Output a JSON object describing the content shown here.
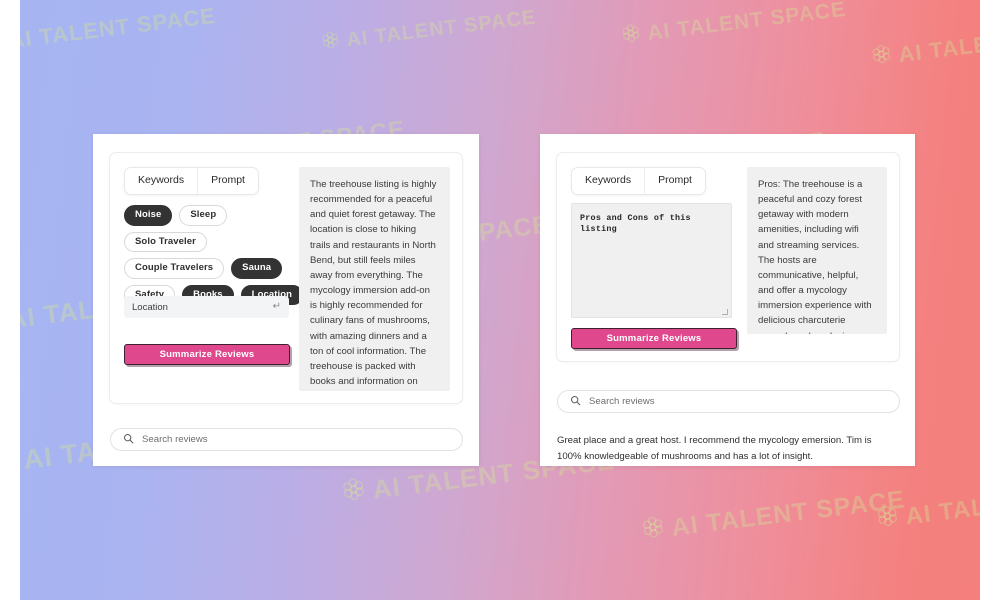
{
  "background": {
    "gradient_start": "#a6b5f2",
    "gradient_mid": "#d0a7cf",
    "gradient_end": "#f4817f",
    "watermark_text": "AI TALENT SPACE",
    "watermark_color": "#d6e296",
    "watermark_icon": "flower-cluster-icon"
  },
  "theme": {
    "chip_active_bg": "#333333",
    "chip_inactive_bg": "#ffffff",
    "button_bg": "#e0488e",
    "summary_bg": "#f0f0f0",
    "card_bg": "#ffffff"
  },
  "left_panel": {
    "tabs": [
      {
        "label": "Keywords",
        "selected": true
      },
      {
        "label": "Prompt",
        "selected": false
      }
    ],
    "chips": [
      {
        "label": "Noise",
        "selected": true
      },
      {
        "label": "Sleep",
        "selected": false
      },
      {
        "label": "Solo Traveler",
        "selected": false
      },
      {
        "label": "Couple Travelers",
        "selected": false
      },
      {
        "label": "Sauna",
        "selected": true
      },
      {
        "label": "Safety",
        "selected": false
      },
      {
        "label": "Books",
        "selected": true
      },
      {
        "label": "Location",
        "selected": true
      }
    ],
    "location_input": {
      "value": "Location",
      "placeholder": "Location",
      "enter_key_glyph": "↵"
    },
    "summarize_button": "Summarize Reviews",
    "summary_text": "The treehouse listing is highly recommended for a peaceful and quiet forest getaway. The location is close to hiking trails and restaurants in North Bend, but still feels miles away from everything. The mycology immersion add-on is highly recommended for culinary fans of mushrooms, with amazing dinners and a ton of cool information. The treehouse is packed with books and information on mycology, and the outdoor shower is a favorite among guests. The hosts are very nice, helpful, and communicative.",
    "search": {
      "placeholder": "Search reviews",
      "value": "",
      "icon": "search-icon"
    }
  },
  "right_panel": {
    "tabs": [
      {
        "label": "Keywords",
        "selected": false
      },
      {
        "label": "Prompt",
        "selected": true
      }
    ],
    "prompt_textarea": {
      "value": "Pros and Cons of this listing",
      "placeholder": "Pros and Cons of this listing"
    },
    "summarize_button": "Summarize Reviews",
    "summary_text": "Pros: The treehouse is a peaceful and cozy forest getaway with modern amenities, including wifi and streaming services. The hosts are communicative, helpful, and offer a mycology immersion experience with delicious charcuterie spreads and a relaxing sauna. The location is great, close to hiking trails and restaurants in North Bend. Cons: None mentioned in the reviews.",
    "search": {
      "placeholder": "Search reviews",
      "value": "",
      "icon": "search-icon"
    },
    "review_text": "Great place and a great host. I recommend the mycology emersion. Tim is 100% knowledgeable of mushrooms and has a lot of insight."
  }
}
